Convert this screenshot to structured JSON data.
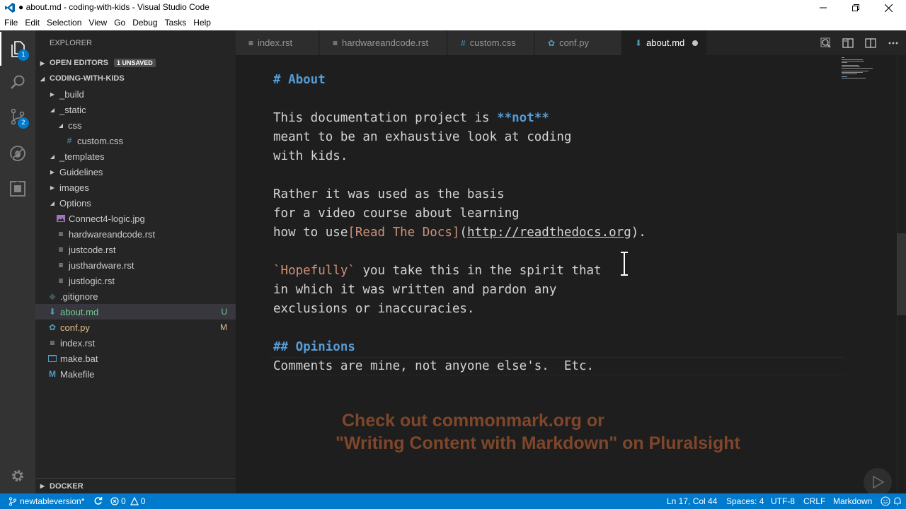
{
  "window": {
    "title": "● about.md - coding-with-kids - Visual Studio Code",
    "minimize_icon": "minimize-icon",
    "maximize_icon": "restore-icon",
    "close_icon": "close-icon"
  },
  "menu": [
    "File",
    "Edit",
    "Selection",
    "View",
    "Go",
    "Debug",
    "Tasks",
    "Help"
  ],
  "activity_bar": {
    "explorer_badge": "1",
    "scm_badge": "2"
  },
  "sidebar": {
    "title": "EXPLORER",
    "open_editors": "OPEN EDITORS",
    "unsaved_badge": "1 UNSAVED",
    "project": "CODING-WITH-KIDS",
    "tree": [
      {
        "label": "_build",
        "status": ""
      },
      {
        "label": "_static",
        "status": ""
      },
      {
        "label": "css",
        "status": ""
      },
      {
        "label": "custom.css",
        "status": ""
      },
      {
        "label": "_templates",
        "status": ""
      },
      {
        "label": "Guidelines",
        "status": ""
      },
      {
        "label": "images",
        "status": ""
      },
      {
        "label": "Options",
        "status": ""
      },
      {
        "label": "Connect4-logic.jpg",
        "status": ""
      },
      {
        "label": "hardwareandcode.rst",
        "status": ""
      },
      {
        "label": "justcode.rst",
        "status": ""
      },
      {
        "label": "justhardware.rst",
        "status": ""
      },
      {
        "label": "justlogic.rst",
        "status": ""
      },
      {
        "label": ".gitignore",
        "status": ""
      },
      {
        "label": "about.md",
        "status": "U"
      },
      {
        "label": "conf.py",
        "status": "M"
      },
      {
        "label": "index.rst",
        "status": ""
      },
      {
        "label": "make.bat",
        "status": ""
      },
      {
        "label": "Makefile",
        "status": ""
      }
    ],
    "docker": "DOCKER"
  },
  "tabs": [
    {
      "label": "index.rst",
      "icon": "hash-icon"
    },
    {
      "label": "hardwareandcode.rst",
      "icon": "hash-icon"
    },
    {
      "label": "custom.css",
      "icon": "hash-icon"
    },
    {
      "label": "conf.py",
      "icon": "python-icon"
    },
    {
      "label": "about.md",
      "icon": "markdown-icon"
    }
  ],
  "editor": {
    "lines": {
      "l1": "# About",
      "l3a": "This documentation project is ",
      "l3b": "**not**",
      "l4": "meant to be an exhaustive look at coding",
      "l5": "with kids.",
      "l7": "Rather it was used as the basis",
      "l8": "for a video course about learning",
      "l9a": "how to use",
      "l9b": "[Read The Docs]",
      "l9c": "(",
      "l9d": "http://readthedocs.org",
      "l9e": ").",
      "l11a": "`Hopefully`",
      "l11b": " you take this in the spirit that",
      "l12": "in which it was written and pardon any",
      "l13": "exclusions or inaccuracies.",
      "l15": "## Opinions",
      "l16": "Comments are mine, not anyone else's.  Etc."
    },
    "overlay_1": "Check out commonmark.org or",
    "overlay_2": "\"Writing Content with Markdown\" on Pluralsight"
  },
  "statusbar": {
    "branch": "newtableversion*",
    "errors": "0",
    "warnings": "0",
    "position": "Ln 17, Col 44",
    "spaces": "Spaces: 4",
    "encoding": "UTF-8",
    "eol": "CRLF",
    "language": "Markdown"
  },
  "colors": {
    "accent": "#007acc",
    "heading": "#569cd6",
    "string": "#ce9178",
    "overlay_text": "#8a4b2c"
  }
}
